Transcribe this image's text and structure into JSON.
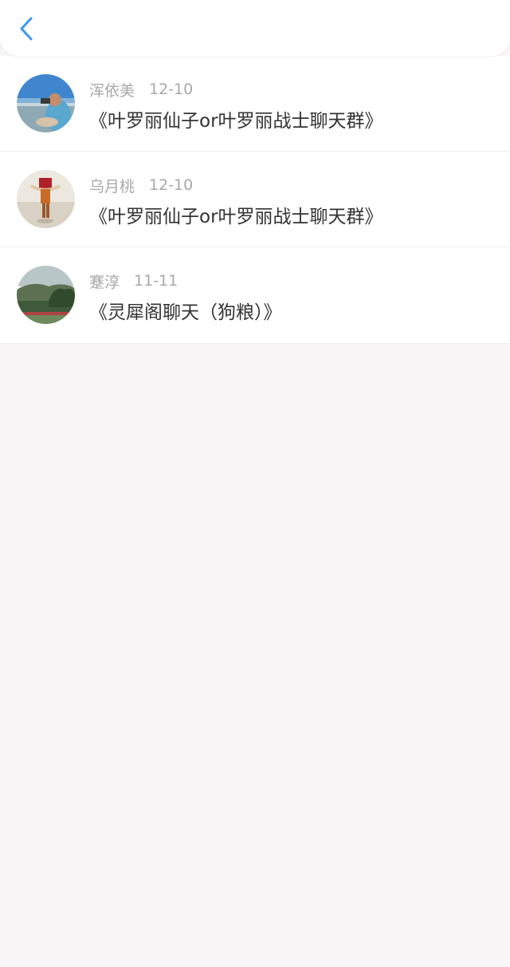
{
  "header": {
    "back_icon": "chevron-left-icon",
    "accent_color": "#3b9ae8"
  },
  "items": [
    {
      "avatar_icon": "user-avatar",
      "author": "浑依美",
      "date": "12-10",
      "title": "《叶罗丽仙子or叶罗丽战士聊天群》"
    },
    {
      "avatar_icon": "user-avatar",
      "author": "乌月桃",
      "date": "12-10",
      "title": "《叶罗丽仙子or叶罗丽战士聊天群》"
    },
    {
      "avatar_icon": "user-avatar",
      "author": "蹇淳",
      "date": "11-11",
      "title": "《灵犀阁聊天（狗粮）》"
    }
  ]
}
